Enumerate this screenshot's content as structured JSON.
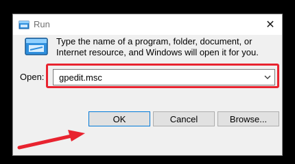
{
  "window": {
    "title": "Run",
    "close_symbol": "✕"
  },
  "content": {
    "description": "Type the name of a program, folder, document, or Internet resource, and Windows will open it for you.",
    "open_label": "Open:",
    "open_value": "gpedit.msc"
  },
  "buttons": {
    "ok": "OK",
    "cancel": "Cancel",
    "browse": "Browse..."
  },
  "icons": {
    "title": "run-icon",
    "main": "run-icon",
    "dropdown": "chevron-down-icon",
    "annotation": "red-arrow-icon"
  },
  "colors": {
    "highlight": "#e8232f",
    "arrow": "#e8232f",
    "ok_border": "#0078d7"
  }
}
